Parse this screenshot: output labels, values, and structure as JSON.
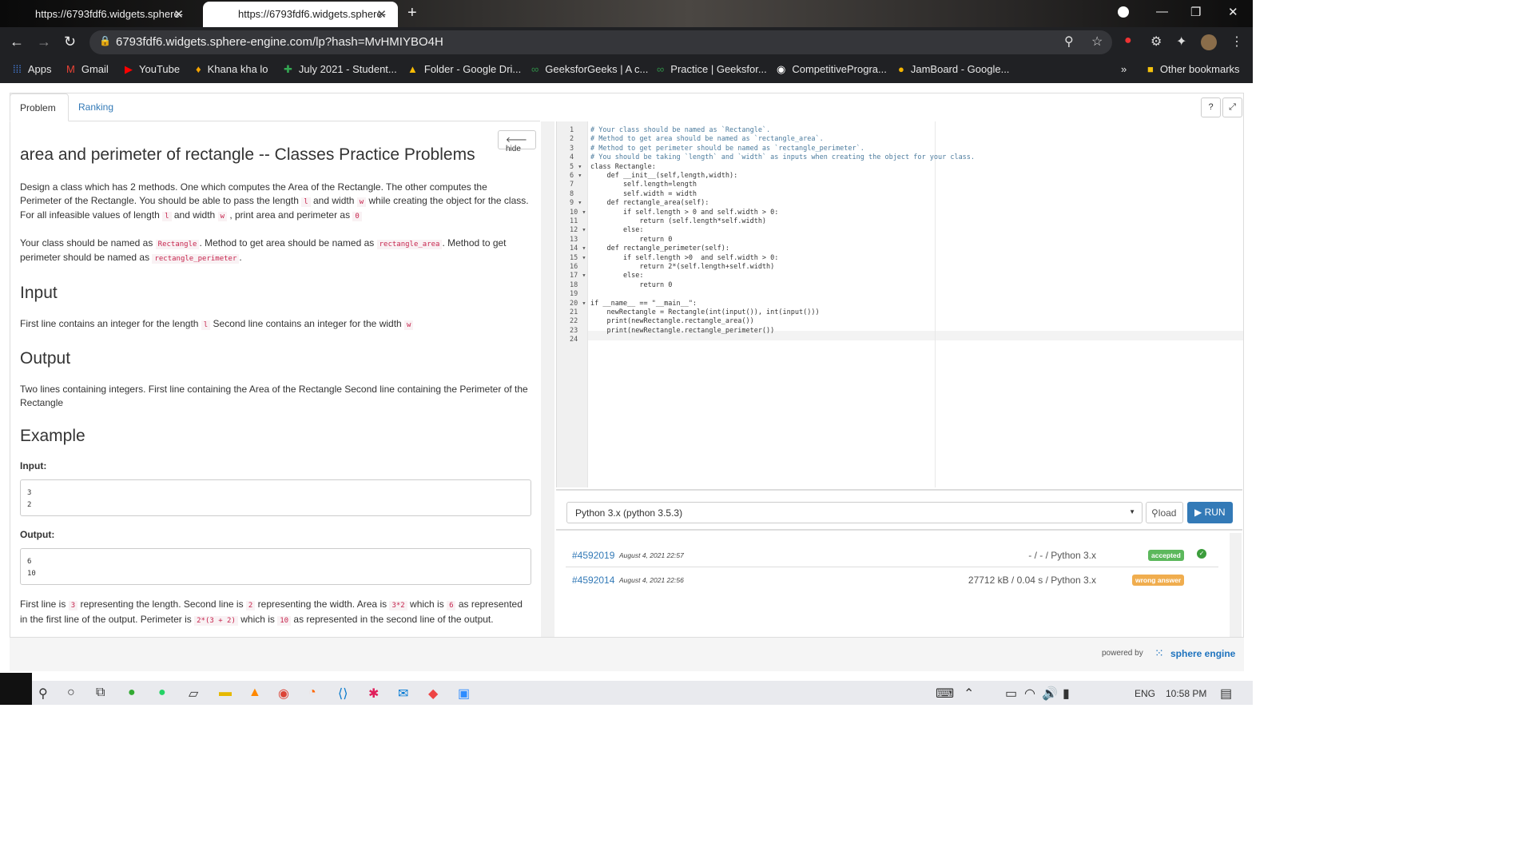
{
  "browser": {
    "tabs": [
      {
        "title": "https://6793fdf6.widgets.sphere-"
      },
      {
        "title": "https://6793fdf6.widgets.sphere-"
      }
    ],
    "url": "6793fdf6.widgets.sphere-engine.com/lp?hash=MvHMIYBO4H",
    "bookmarks": [
      "Apps",
      "Gmail",
      "YouTube",
      "Khana kha lo",
      "July 2021 - Student...",
      "Folder - Google Dri...",
      "GeeksforGeeks | A c...",
      "Practice | Geeksfor...",
      "CompetitiveProgra...",
      "JamBoard - Google..."
    ],
    "other_bookmarks": "Other bookmarks"
  },
  "tabs": {
    "problem": "Problem",
    "ranking": "Ranking"
  },
  "buttons": {
    "hide": "hide",
    "help": "?",
    "expand": "⤢"
  },
  "problem": {
    "title": "area and perimeter of rectangle -- Classes Practice Problems",
    "desc1_a": "Design a class which has 2 methods. One which computes the Area of the Rectangle. The other computes the Perimeter of the Rectangle. You should be able to pass the length ",
    "code_l": "l",
    "desc1_b": " and width ",
    "code_w": "w",
    "desc1_c": " while creating the object for the class. For all infeasible values of length ",
    "desc1_d": " and width ",
    "desc1_e": " , print area and perimeter as ",
    "code_0": "0",
    "desc2_a": "Your class should be named as ",
    "code_rect": "Rectangle",
    "desc2_b": ". Method to get area should be named as ",
    "code_area": "rectangle_area",
    "desc2_c": ". Method to get perimeter should be named as ",
    "code_perim": "rectangle_perimeter",
    "desc2_d": ".",
    "input_heading": "Input",
    "input_text_a": "First line contains an integer for the length ",
    "input_text_b": " Second line contains an integer for the width ",
    "output_heading": "Output",
    "output_text": "Two lines containing integers. First line containing the Area of the Rectangle Second line containing the Perimeter of the Rectangle",
    "example_heading": "Example",
    "input_label": "Input:",
    "input_values": [
      "3",
      "2"
    ],
    "output_label": "Output:",
    "output_values": [
      "6",
      "10"
    ],
    "expl_a": "First line is ",
    "code_3": "3",
    "expl_b": " representing the length. Second line is ",
    "code_2": "2",
    "expl_c": " representing the width. Area is ",
    "code_3x2": "3*2",
    "expl_d": " which is ",
    "code_6": "6",
    "expl_e": " as represented in the first line of the output. Perimeter is ",
    "code_p": "2*(3 + 2)",
    "expl_f": " which is ",
    "code_10": "10",
    "expl_g": " as represented in the second line of the output."
  },
  "editor": {
    "lines": [
      "# Your class should be named as `Rectangle`.",
      "# Method to get area should be named as `rectangle_area`.",
      "# Method to get perimeter should be named as `rectangle_perimeter`.",
      "# You should be taking `length` and `width` as inputs when creating the object for your class.",
      "class Rectangle:",
      "    def __init__(self,length,width):",
      "        self.length=length",
      "        self.width = width",
      "    def rectangle_area(self):",
      "        if self.length > 0 and self.width > 0:",
      "            return (self.length*self.width)",
      "        else:",
      "            return 0",
      "    def rectangle_perimeter(self):",
      "        if self.length >0  and self.width > 0:",
      "            return 2*(self.length+self.width)",
      "        else:",
      "            return 0",
      "",
      "if __name__ == \"__main__\":",
      "    newRectangle = Rectangle(int(input()), int(input()))",
      "    print(newRectangle.rectangle_area())",
      "    print(newRectangle.rectangle_perimeter())",
      ""
    ],
    "fold_lines": [
      5,
      6,
      9,
      10,
      12,
      14,
      15,
      17,
      20
    ]
  },
  "run": {
    "language": "Python 3.x (python 3.5.3)",
    "load_label": "load",
    "run_label": "RUN"
  },
  "submissions": [
    {
      "id": "#4592019",
      "date": "August 4, 2021 22:57",
      "result": "- / - / Python 3.x",
      "status": "accepted",
      "color": "#5cb85c"
    },
    {
      "id": "#4592014",
      "date": "August 4, 2021 22:56",
      "result": "27712 kB / 0.04 s / Python 3.x",
      "status": "wrong answer",
      "color": "#f0ad4e"
    }
  ],
  "footer": {
    "powered_by": "powered by",
    "brand": "sphere engine"
  },
  "taskbar": {
    "lang": "ENG",
    "time": "10:58 PM"
  }
}
